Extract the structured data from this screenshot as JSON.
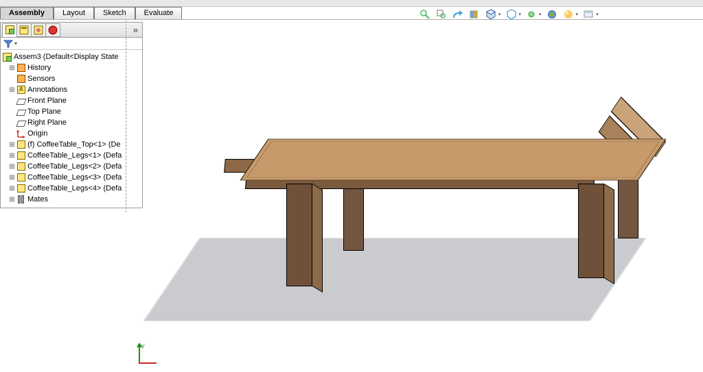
{
  "tabs": {
    "assembly": "Assembly",
    "layout": "Layout",
    "sketch": "Sketch",
    "evaluate": "Evaluate"
  },
  "tree": {
    "root": "Assem3  (Default<Display State",
    "history": "History",
    "sensors": "Sensors",
    "annotations": "Annotations",
    "front_plane": "Front Plane",
    "top_plane": "Top Plane",
    "right_plane": "Right Plane",
    "origin": "Origin",
    "part_top": "(f) CoffeeTable_Top<1> (De",
    "part_leg1": "CoffeeTable_Legs<1> (Defa",
    "part_leg2": "CoffeeTable_Legs<2> (Defa",
    "part_leg3": "CoffeeTable_Legs<3> (Defa",
    "part_leg4": "CoffeeTable_Legs<4> (Defa",
    "mates": "Mates"
  },
  "triad": {
    "y_label": "Y"
  },
  "glyph": {
    "plus": "⊞",
    "minus": "⊟",
    "expand": "»",
    "filter_drop": "▾"
  }
}
